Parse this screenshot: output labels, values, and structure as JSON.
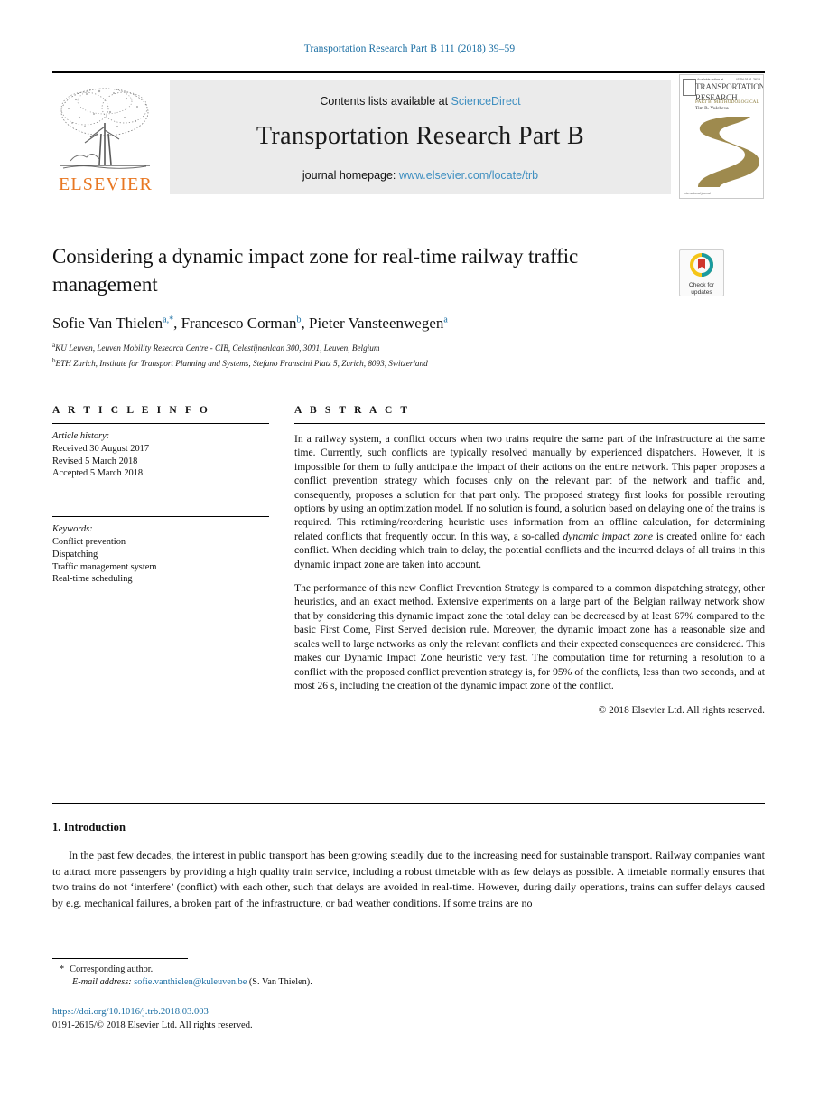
{
  "running_head": "Transportation Research Part B 111 (2018) 39–59",
  "header": {
    "contents_prefix": "Contents lists available at",
    "sciencedirect_link": "ScienceDirect",
    "journal_title": "Transportation Research Part B",
    "homepage_prefix": "journal homepage:",
    "homepage_link": "www.elsevier.com/locate/trb",
    "publisher_logo_text": "ELSEVIER",
    "cover": {
      "header_left": "Available online at",
      "header_right": "ISSN 0191-2615",
      "line1": "TRANSPORTATION",
      "line2": "RESEARCH",
      "line3": "PART B: METHODOLOGICAL",
      "line4": "Tim R. Vulcheva",
      "footer": "International journal"
    }
  },
  "article": {
    "title": "Considering a dynamic impact zone for real-time railway traffic management",
    "crossmark": {
      "line1": "Check for",
      "line2": "updates"
    },
    "authors": [
      {
        "name": "Sofie Van Thielen",
        "marks": "a,*"
      },
      {
        "name": "Francesco Corman",
        "marks": "b"
      },
      {
        "name": "Pieter Vansteenwegen",
        "marks": "a"
      }
    ],
    "affiliations": [
      {
        "mark": "a",
        "text": "KU Leuven, Leuven Mobility Research Centre - CIB, Celestijnenlaan 300, 3001, Leuven, Belgium"
      },
      {
        "mark": "b",
        "text": "ETH Zurich, Institute for Transport Planning and Systems, Stefano Franscini Platz 5, Zurich, 8093, Switzerland"
      }
    ]
  },
  "article_info": {
    "heading": "A R T I C L E   I N F O",
    "history_title": "Article history:",
    "history": [
      "Received 30 August 2017",
      "Revised 5 March 2018",
      "Accepted 5 March 2018"
    ],
    "keywords_title": "Keywords:",
    "keywords": [
      "Conflict prevention",
      "Dispatching",
      "Traffic management system",
      "Real-time scheduling"
    ]
  },
  "abstract": {
    "heading": "A B S T R A C T",
    "paragraph_1_part_a": "In a railway system, a conflict occurs when two trains require the same part of the infrastructure at the same time. Currently, such conflicts are typically resolved manually by experienced dispatchers. However, it is impossible for them to fully anticipate the impact of their actions on the entire network. This paper proposes a conflict prevention strategy which focuses only on the relevant part of the network and traffic and, consequently, proposes a solution for that part only. The proposed strategy first looks for possible rerouting options by using an optimization model. If no solution is found, a solution based on delaying one of the trains is required. This retiming/reordering heuristic uses information from an offline calculation, for determining related conflicts that frequently occur. In this way, a so-called ",
    "paragraph_1_italic": "dynamic impact zone",
    "paragraph_1_part_b": " is created online for each conflict. When deciding which train to delay, the potential conflicts and the incurred delays of all trains in this dynamic impact zone are taken into account.",
    "paragraph_2": "The performance of this new Conflict Prevention Strategy is compared to a common dispatching strategy, other heuristics, and an exact method. Extensive experiments on a large part of the Belgian railway network show that by considering this dynamic impact zone the total delay can be decreased by at least 67% compared to the basic First Come, First Served decision rule. Moreover, the dynamic impact zone has a reasonable size and scales well to large networks as only the relevant conflicts and their expected consequences are considered. This makes our Dynamic Impact Zone heuristic very fast. The computation time for returning a resolution to a conflict with the proposed conflict prevention strategy is, for 95% of the conflicts, less than two seconds, and at most 26 s, including the creation of the dynamic impact zone of the conflict.",
    "copyright": "© 2018 Elsevier Ltd. All rights reserved."
  },
  "body": {
    "intro_heading": "1. Introduction",
    "intro_paragraph": "In the past few decades, the interest in public transport has been growing steadily due to the increasing need for sustainable transport. Railway companies want to attract more passengers by providing a high quality train service, including a robust timetable with as few delays as possible. A timetable normally ensures that two trains do not ‘interfere’ (conflict) with each other, such that delays are avoided in real-time. However, during daily operations, trains can suffer delays caused by e.g. mechanical failures, a broken part of the infrastructure, or bad weather conditions. If some trains are no"
  },
  "footer": {
    "corresponding_author": "Corresponding author.",
    "email_label": "E-mail address:",
    "email": "sofie.vanthielen@kuleuven.be",
    "email_owner": "(S. Van Thielen).",
    "doi": "https://doi.org/10.1016/j.trb.2018.03.003",
    "issn_copyright": "0191-2615/© 2018 Elsevier Ltd. All rights reserved."
  },
  "colors": {
    "link_blue": "#1a6ea3",
    "sciencedirect_blue": "#3f8fc0",
    "elsevier_orange": "#e87722",
    "banner_gray": "#ebebeb",
    "crossmark_yellow": "#f5c518",
    "crossmark_teal": "#1a9ba1",
    "crossmark_red": "#d0352b"
  }
}
